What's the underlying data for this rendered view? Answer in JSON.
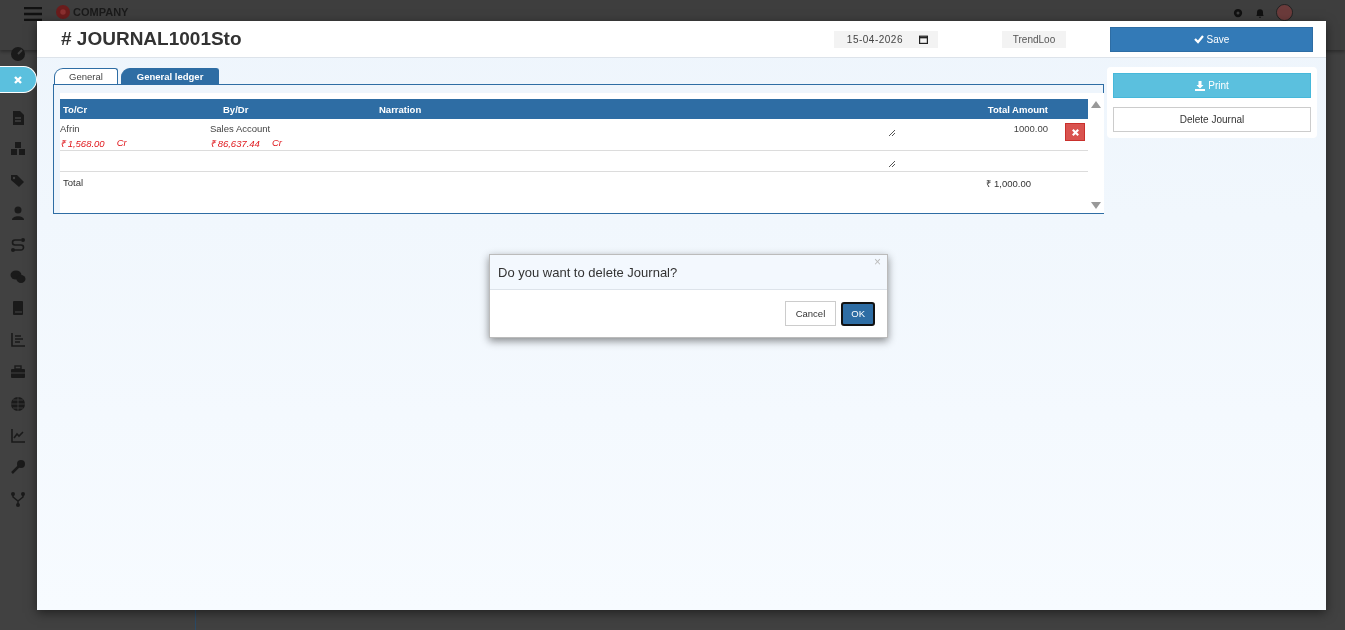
{
  "app_header": {
    "brand": "COMPANY"
  },
  "journal": {
    "title": "# JOURNAL1001Sto",
    "date": "15-04-2026",
    "company": "TrendLoo",
    "save_label": "Save",
    "tabs": [
      {
        "label": "General",
        "selected": false
      },
      {
        "label": "General ledger",
        "selected": true
      }
    ],
    "table": {
      "columns": [
        "To/Cr",
        "By/Dr",
        "Narration",
        "Total Amount"
      ],
      "rows": [
        {
          "to": "Afrin",
          "to_balance": "₹ 1,568.00",
          "to_side": "Cr",
          "by": "Sales Account",
          "by_balance": "₹ 86,637.44",
          "by_side": "Cr",
          "amount": "1000.00"
        },
        {}
      ],
      "total_label": "Total",
      "total": "₹ 1,000.00"
    },
    "actions": {
      "print": "Print",
      "delete": "Delete Journal"
    }
  },
  "dialog": {
    "message": "Do you want to delete Journal?",
    "close": "×",
    "buttons": [
      {
        "label": "Cancel",
        "kind": "default"
      },
      {
        "label": "OK",
        "kind": "primary"
      }
    ]
  }
}
